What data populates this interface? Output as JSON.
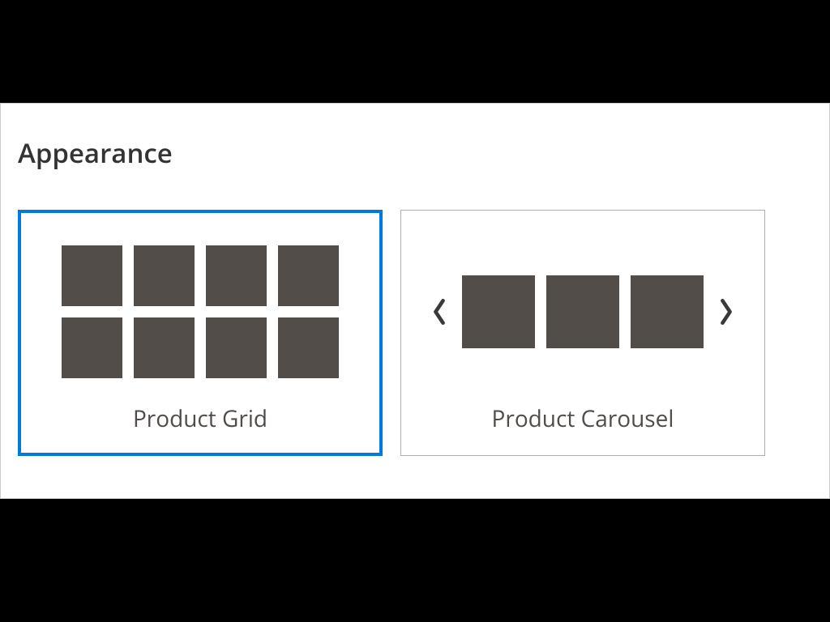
{
  "section": {
    "title": "Appearance"
  },
  "options": {
    "grid": {
      "label": "Product Grid",
      "selected": true
    },
    "carousel": {
      "label": "Product Carousel",
      "selected": false
    }
  }
}
